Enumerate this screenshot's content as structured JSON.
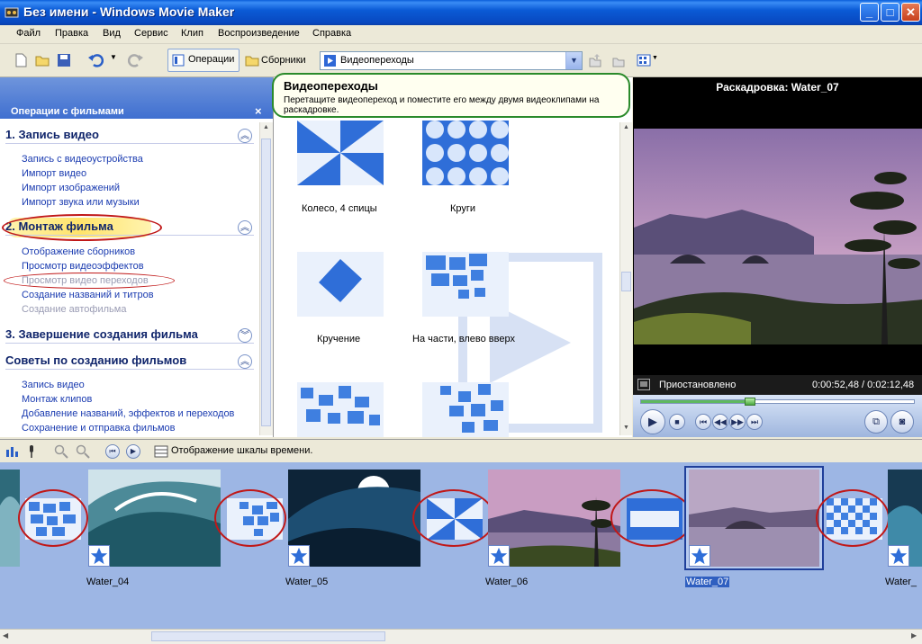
{
  "window": {
    "title": "Без имени - Windows Movie Maker",
    "min": "_",
    "max": "□",
    "close": "✕"
  },
  "menu": [
    "Файл",
    "Правка",
    "Вид",
    "Сервис",
    "Клип",
    "Воспроизведение",
    "Справка"
  ],
  "toolbar": {
    "operations_label": "Операции",
    "collections_label": "Сборники",
    "combo_value": "Видеопереходы"
  },
  "taskpane": {
    "header": "Операции с фильмами",
    "close": "×",
    "sections": [
      {
        "title": "1. Запись видео",
        "links": [
          "Запись с видеоустройства",
          "Импорт видео",
          "Импорт изображений",
          "Импорт звука или музыки"
        ]
      },
      {
        "title": "2. Монтаж фильма",
        "links": [
          "Отображение сборников",
          "Просмотр видеоэффектов",
          "Просмотр видео переходов",
          "Создание названий и титров",
          "Создание автофильма"
        ]
      },
      {
        "title": "3. Завершение создания фильма"
      },
      {
        "title": "Советы по созданию фильмов",
        "links": [
          "Запись видео",
          "Монтаж клипов",
          "Добавление названий, эффектов и переходов",
          "Сохранение и отправка фильмов"
        ]
      }
    ]
  },
  "tooltip": {
    "title": "Видеопереходы",
    "body": "Перетащите видеопереход и поместите его между двумя видеоклипами на раскадровке."
  },
  "transitions": [
    {
      "label": "Колесо, 4 спицы"
    },
    {
      "label": "Круги"
    },
    {
      "label": "Кручение"
    },
    {
      "label": "На части, влево вверх"
    }
  ],
  "preview": {
    "title": "Раскадровка: Water_07",
    "status": "Приостановлено",
    "time": "0:00:52,48 / 0:02:12,48",
    "progress": 0.4
  },
  "storyboard_toolbar": {
    "label": "Отображение шкалы времени."
  },
  "clips": [
    "Water_04",
    "Water_05",
    "Water_06",
    "Water_07",
    "Water_"
  ],
  "colors": {
    "titlebar": "#0a5ed9",
    "storyboard_bg": "#9db6e4",
    "link": "#1a3bb0",
    "highlight_circle": "#c01818",
    "tooltip_border": "#2a8a2a"
  }
}
